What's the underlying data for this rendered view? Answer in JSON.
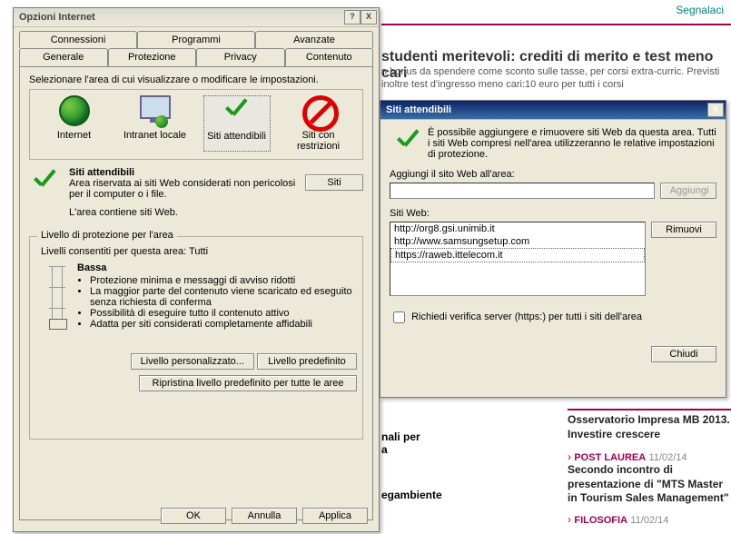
{
  "bg": {
    "segnalaci": "Segnalaci",
    "headline": "studenti meritevoli: crediti di merito e test meno cari",
    "subtext": "n bonus da spendere come sconto sulle tasse, per corsi extra-curric. Previsti inoltre test d'ingresso meno cari:10 euro per tutti i corsi",
    "left_snip1": "nali per\na",
    "left_snip2": "egambiente",
    "rcol": {
      "t1": "Osservatorio Impresa MB 2013. Investire crescere",
      "cat2": "POST LAUREA",
      "date2": "11/02/14",
      "t2": "Secondo incontro di presentazione di \"MTS Master in Tourism Sales Management\"",
      "cat3": "FILOSOFIA",
      "date3": "11/02/14"
    }
  },
  "opts": {
    "title": "Opzioni Internet",
    "help": "?",
    "close": "X",
    "tabs_row1": [
      "Connessioni",
      "Programmi",
      "Avanzate"
    ],
    "tabs_row2": [
      "Generale",
      "Protezione",
      "Privacy",
      "Contenuto"
    ],
    "intro": "Selezionare l'area di cui visualizzare o modificare le impostazioni.",
    "zones": {
      "internet": "Internet",
      "intranet": "Intranet locale",
      "trusted": "Siti attendibili",
      "restricted": "Siti con restrizioni"
    },
    "zone_info": {
      "title": "Siti attendibili",
      "desc": "Area riservata ai siti Web considerati non pericolosi per il computer o i file.",
      "contains": "L'area contiene siti Web.",
      "sites_btn": "Siti"
    },
    "level": {
      "legend": "Livello di protezione per l'area",
      "allowed": "Livelli consentiti per questa area: Tutti",
      "name": "Bassa",
      "bullets": [
        "Protezione minima e messaggi di avviso ridotti",
        "La maggior parte del contenuto viene scaricato ed eseguito senza richiesta di conferma",
        "Possibilità di eseguire tutto il contenuto attivo",
        "Adatta per siti considerati completamente affidabili"
      ],
      "custom_btn": "Livello personalizzato...",
      "default_btn": "Livello predefinito",
      "reset_btn": "Ripristina livello predefinito per tutte le aree"
    },
    "ok": "OK",
    "cancel": "Annulla",
    "apply": "Applica"
  },
  "trusted": {
    "title": "Siti attendibili",
    "close": "X",
    "msg": "È possibile aggiungere e rimuovere siti Web da questa area. Tutti i siti Web compresi nell'area utilizzeranno le relative impostazioni di protezione.",
    "add_label": "Aggiungi il sito Web all'area:",
    "add_btn": "Aggiungi",
    "list_label": "Siti Web:",
    "sites": [
      "http://org8.gsi.unimib.it",
      "http://www.samsungsetup.com",
      "https://raweb.ittelecom.it"
    ],
    "remove_btn": "Rimuovi",
    "https_check": "Richiedi verifica server (https:) per tutti i siti dell'area",
    "close_btn": "Chiudi"
  }
}
